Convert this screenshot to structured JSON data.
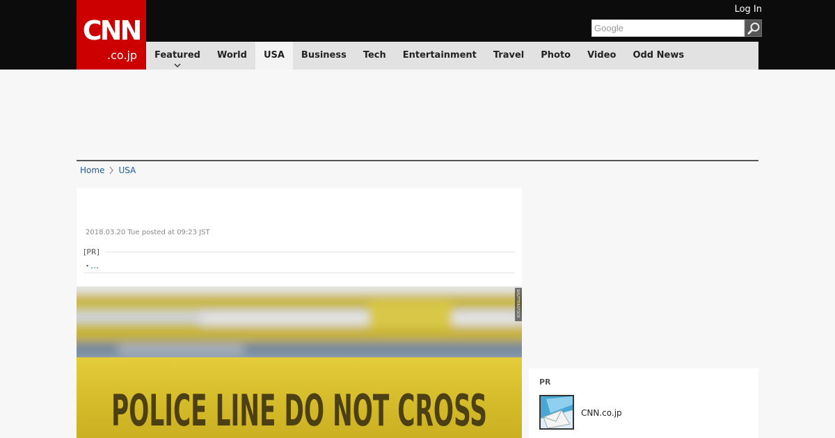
{
  "header": {
    "logo": {
      "big": "CNN",
      "small": ".co.jp"
    },
    "login_label": "Log In",
    "search": {
      "placeholder": "Google",
      "value": "",
      "icon": "magnifier-icon"
    },
    "nav": [
      {
        "label": "Featured",
        "has_dropdown": true
      },
      {
        "label": "World"
      },
      {
        "label": "USA",
        "active": true
      },
      {
        "label": "Business"
      },
      {
        "label": "Tech"
      },
      {
        "label": "Entertainment"
      },
      {
        "label": "Travel"
      },
      {
        "label": "Photo"
      },
      {
        "label": "Video"
      },
      {
        "label": "Odd News"
      }
    ]
  },
  "breadcrumb": {
    "home": "Home",
    "current": "USA",
    "separator_icon": "chevron-right-icon"
  },
  "article": {
    "date": "2018.03.20 Tue posted at 09:23 JST",
    "pr": {
      "label": "[PR]",
      "bullet": "・",
      "link": "…"
    },
    "photo": {
      "tape_text": "POLICE LINE DO NOT CROSS",
      "credit": "SHUTTERSTOCK"
    }
  },
  "sidebar": {
    "pr_label": "PR",
    "item": {
      "name": "CNN.co.jp",
      "icon": "mail-thumbnail-icon"
    }
  },
  "colors": {
    "brand_red": "#cc0000",
    "header_black": "#0c0c0c",
    "nav_gray": "#e2e2e2",
    "link_blue": "#1d5a93",
    "tape_yellow": "#d8c02a"
  }
}
